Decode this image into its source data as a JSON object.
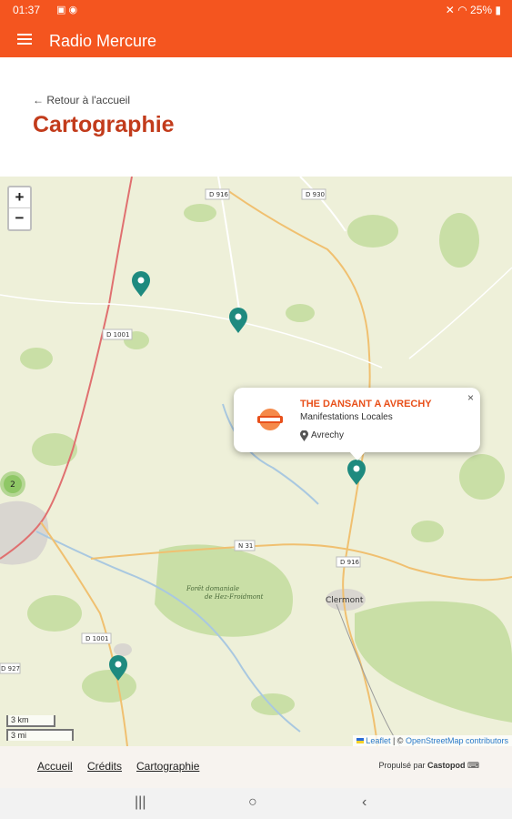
{
  "status": {
    "time": "01:37",
    "battery": "25%"
  },
  "app": {
    "title": "Radio Mercure"
  },
  "header": {
    "back_label": "← Retour à l'accueil",
    "page_title": "Cartographie"
  },
  "map": {
    "zoom_in": "+",
    "zoom_out": "−",
    "road_labels": [
      "D 916",
      "D 930",
      "D 1001",
      "N 31",
      "D 916",
      "D 1001",
      "D 927"
    ],
    "place_labels": [
      "Clermont",
      "Forêt domaniale de Hez-Froidmont"
    ],
    "cluster_count": "2",
    "popup": {
      "title": "THE DANSANT A AVRECHY",
      "category": "Manifestations Locales",
      "location": "Avrechy",
      "close": "×"
    },
    "scale_km": "3 km",
    "scale_mi": "3 mi",
    "attribution": {
      "leaflet": "Leaflet",
      "sep": " | © ",
      "osm": "OpenStreetMap contributors"
    },
    "colors": {
      "marker": "#1e8a7f",
      "cluster": "#8fc766",
      "road_major": "#e07070",
      "road_minor": "#f0c070"
    }
  },
  "footer": {
    "links": [
      "Accueil",
      "Crédits",
      "Cartographie"
    ],
    "powered_prefix": "Propulsé par",
    "powered_brand": "Castopod"
  },
  "navbar": {
    "recent": "|||",
    "home": "○",
    "back": "‹"
  }
}
